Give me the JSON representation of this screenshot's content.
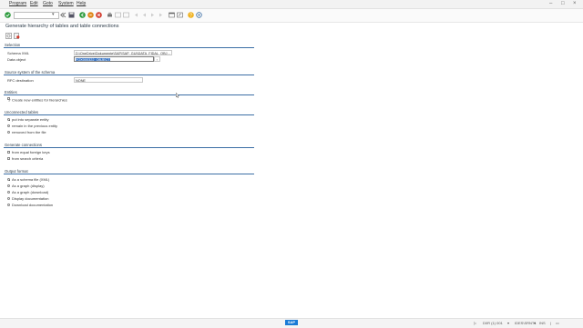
{
  "menu": {
    "items": [
      "Program",
      "Edit",
      "Goto",
      "System",
      "Help"
    ]
  },
  "title": "Generate hierarchy of tables and table connections",
  "sections": {
    "selection": {
      "title": "Selection",
      "schema_xml_label": "Schema XML",
      "schema_xml_value": "D:\\OneDrive\\Dokumente\\SAP\\SAP_GUI\\DATA_FIDAL_OBJ...",
      "data_object_label": "Data object",
      "data_object_value": "FOX000322_OBJECT"
    },
    "source": {
      "title": "Source system of the schema",
      "rfc_label": "RFC destination",
      "rfc_value": "NONE"
    },
    "entities": {
      "title": "Entities",
      "create_new": "Create new entities for hierarchies"
    },
    "unconnected": {
      "title": "Unconnected tables",
      "options": [
        "put into separate entity",
        "remain in the previous entity",
        "removed from the file"
      ]
    },
    "generate": {
      "title": "Generate connections",
      "options": [
        "from equal foreign keys",
        "from search criteria"
      ]
    },
    "output": {
      "title": "Output format",
      "options": [
        "As a schema file (XML)",
        "As a graph (display)",
        "As a graph (download)",
        "Display documentation",
        "Download documentation"
      ]
    }
  },
  "statusbar": {
    "logo": "SAP",
    "system": "D0R (1) 001",
    "server": "IDES\\SRNT1",
    "mode": "INS"
  },
  "colors": {
    "accent_line": "#3b6ea5",
    "selection": "#3875c6",
    "ok_green": "#2e9b3e",
    "cancel_red": "#d33a2c"
  }
}
